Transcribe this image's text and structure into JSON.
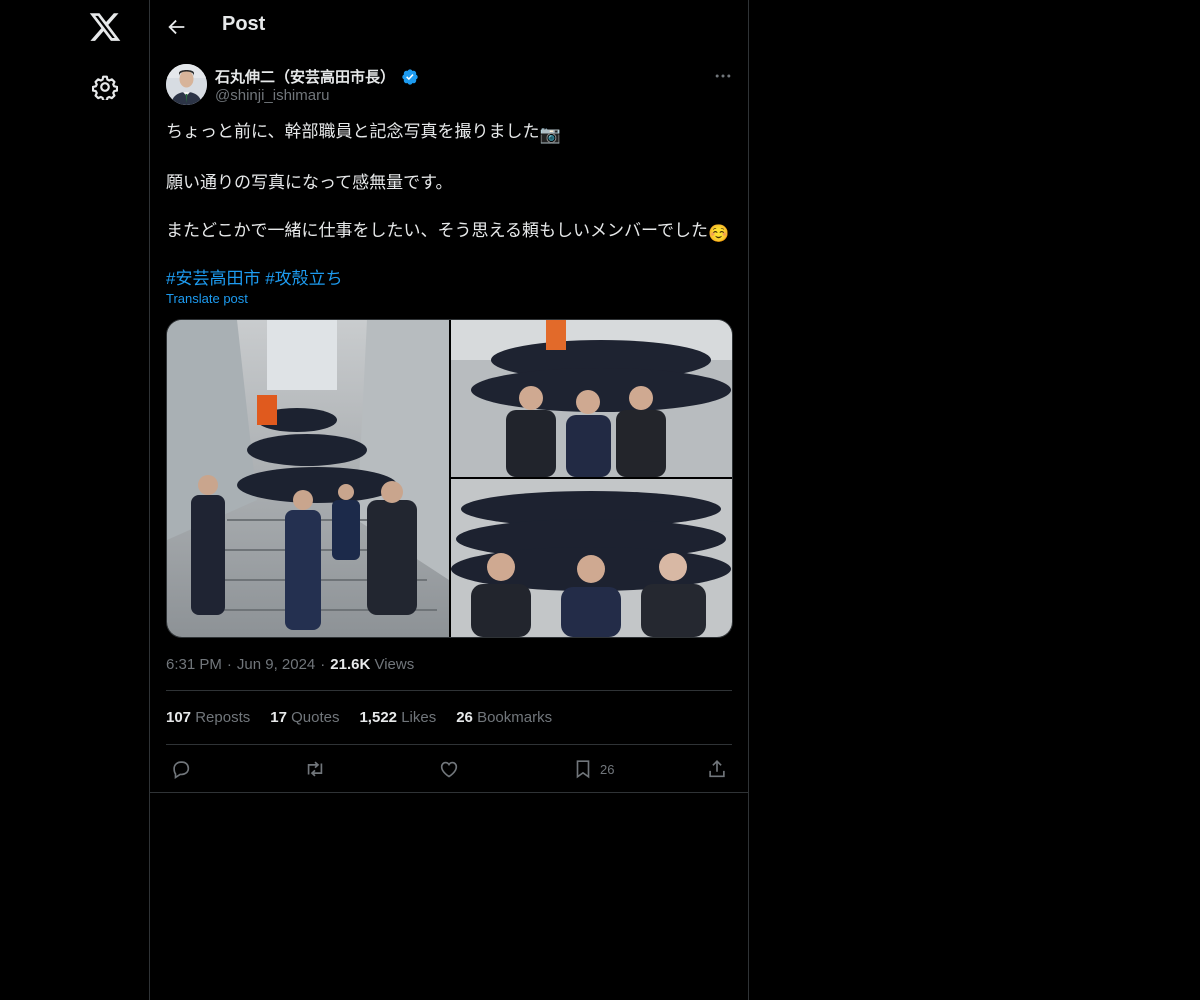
{
  "header": {
    "title": "Post"
  },
  "author": {
    "name": "石丸伸二（安芸高田市長）",
    "handle": "@shinji_ishimaru"
  },
  "tweet": {
    "line1": "ちょっと前に、幹部職員と記念写真を撮りました",
    "line1_emoji": "📷",
    "line2": "願い通りの写真になって感無量です。",
    "line3": "またどこかで一緒に仕事をしたい、そう思える頼もしいメンバーでした",
    "line3_emoji": "☺️",
    "hashtag1": "#安芸高田市",
    "hashtag2": "#攻殻立ち",
    "translate": "Translate post"
  },
  "meta": {
    "time": "6:31 PM",
    "date": "Jun 9, 2024",
    "views_count": "21.6K",
    "views_label": "Views"
  },
  "stats": {
    "reposts_count": "107",
    "reposts_label": "Reposts",
    "quotes_count": "17",
    "quotes_label": "Quotes",
    "likes_count": "1,522",
    "likes_label": "Likes",
    "bookmarks_count": "26",
    "bookmarks_label": "Bookmarks"
  },
  "actions": {
    "bookmark_count": "26"
  },
  "icons": [
    "x-logo-icon",
    "gear-icon",
    "back-arrow-icon",
    "verified-badge-icon",
    "more-icon",
    "reply-icon",
    "repost-icon",
    "like-icon",
    "bookmark-icon",
    "share-icon"
  ],
  "colors": {
    "background": "#000000",
    "text": "#e7e9ea",
    "muted": "#71767b",
    "accent": "#1d9bf0",
    "border": "#2f3336"
  }
}
